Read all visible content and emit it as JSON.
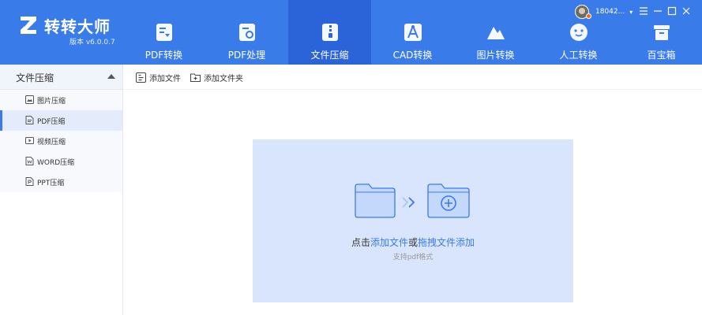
{
  "app": {
    "name": "转转大师",
    "version": "版本 v6.0.0.7",
    "logo_icon": "z-logo-icon"
  },
  "colors": {
    "header_bg": "#3a7bea",
    "nav_active_bg": "#2b63d9",
    "dropzone_bg": "#d8e5fc",
    "link": "#3a7bea"
  },
  "nav": {
    "items": [
      {
        "label": "PDF转换",
        "icon": "pdf-convert-icon",
        "active": false
      },
      {
        "label": "PDF处理",
        "icon": "pdf-process-icon",
        "active": false
      },
      {
        "label": "文件压缩",
        "icon": "file-compress-icon",
        "active": true
      },
      {
        "label": "CAD转换",
        "icon": "cad-convert-icon",
        "active": false
      },
      {
        "label": "图片转换",
        "icon": "image-convert-icon",
        "active": false
      },
      {
        "label": "人工转换",
        "icon": "manual-convert-icon",
        "active": false
      },
      {
        "label": "百宝箱",
        "icon": "toolbox-icon",
        "active": false
      }
    ]
  },
  "user": {
    "name": "18042...",
    "caret": "▾"
  },
  "window_controls": [
    "menu-icon",
    "minimize-icon",
    "maximize-icon",
    "close-icon"
  ],
  "sidebar": {
    "header": "文件压缩",
    "items": [
      {
        "label": "图片压缩",
        "icon": "image-file-icon",
        "active": false
      },
      {
        "label": "PDF压缩",
        "icon": "pdf-file-icon",
        "active": true
      },
      {
        "label": "视频压缩",
        "icon": "video-file-icon",
        "active": false
      },
      {
        "label": "WORD压缩",
        "icon": "word-file-icon",
        "active": false
      },
      {
        "label": "PPT压缩",
        "icon": "ppt-file-icon",
        "active": false
      }
    ]
  },
  "toolbar": {
    "add_file": "添加文件",
    "add_folder": "添加文件夹"
  },
  "dropzone": {
    "prefix": "点击",
    "add_link": "添加文件",
    "middle": "或",
    "drag_link": "拖拽文件添加",
    "subtitle": "支持pdf格式"
  }
}
